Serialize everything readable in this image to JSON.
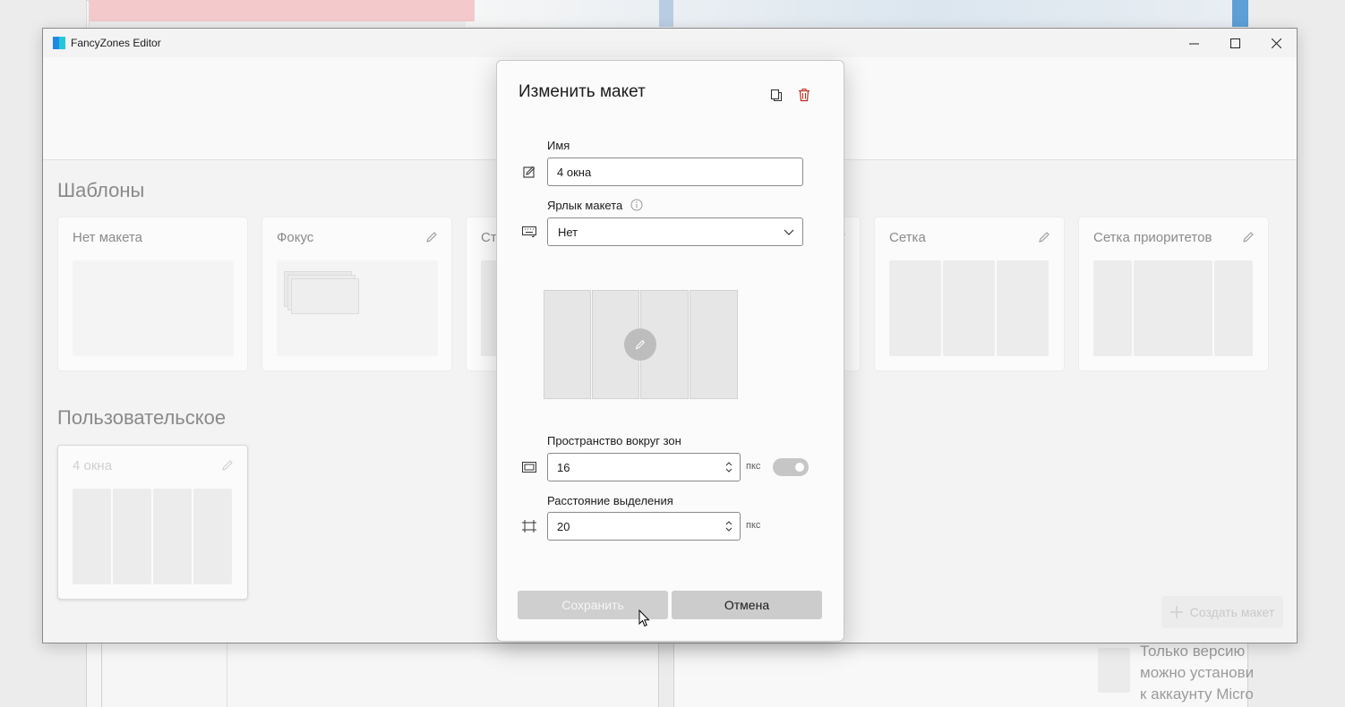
{
  "window": {
    "title": "FancyZones Editor",
    "controls": {
      "minimize": "─",
      "maximize": "☐",
      "close": "✕"
    }
  },
  "sections": {
    "templates_title": "Шаблоны",
    "custom_title": "Пользовательское"
  },
  "templates": [
    {
      "title": "Нет макета",
      "editable": false
    },
    {
      "title": "Фокус",
      "editable": true
    },
    {
      "title": "Сто",
      "editable": true
    },
    {
      "title": "Сетка",
      "editable": true
    },
    {
      "title": "Сетка приоритетов",
      "editable": true
    }
  ],
  "custom_layouts": [
    {
      "title": "4 окна",
      "zones": 4
    }
  ],
  "create_button": {
    "label": "Создать макет",
    "icon": "plus-icon"
  },
  "dialog": {
    "title": "Изменить макет",
    "icons": {
      "copy": "copy-icon",
      "delete": "delete-icon"
    },
    "name": {
      "label": "Имя",
      "value": "4 окна"
    },
    "shortcut": {
      "label": "Ярлык макета",
      "value": "Нет"
    },
    "spacing": {
      "label": "Пространство вокруг зон",
      "value": "16",
      "unit": "пкс",
      "enabled": true
    },
    "distance": {
      "label": "Расстояние выделения",
      "value": "20",
      "unit": "пкс"
    },
    "preview_zones": 4,
    "save_label": "Сохранить",
    "cancel_label": "Отмена"
  },
  "background_note": [
    "Только версию",
    "можно установи",
    "к аккаунту Micro"
  ],
  "colors": {
    "accent_delete": "#c42b1c",
    "app_icon_blue": "#1e88e5",
    "app_icon_teal": "#26c6da"
  }
}
